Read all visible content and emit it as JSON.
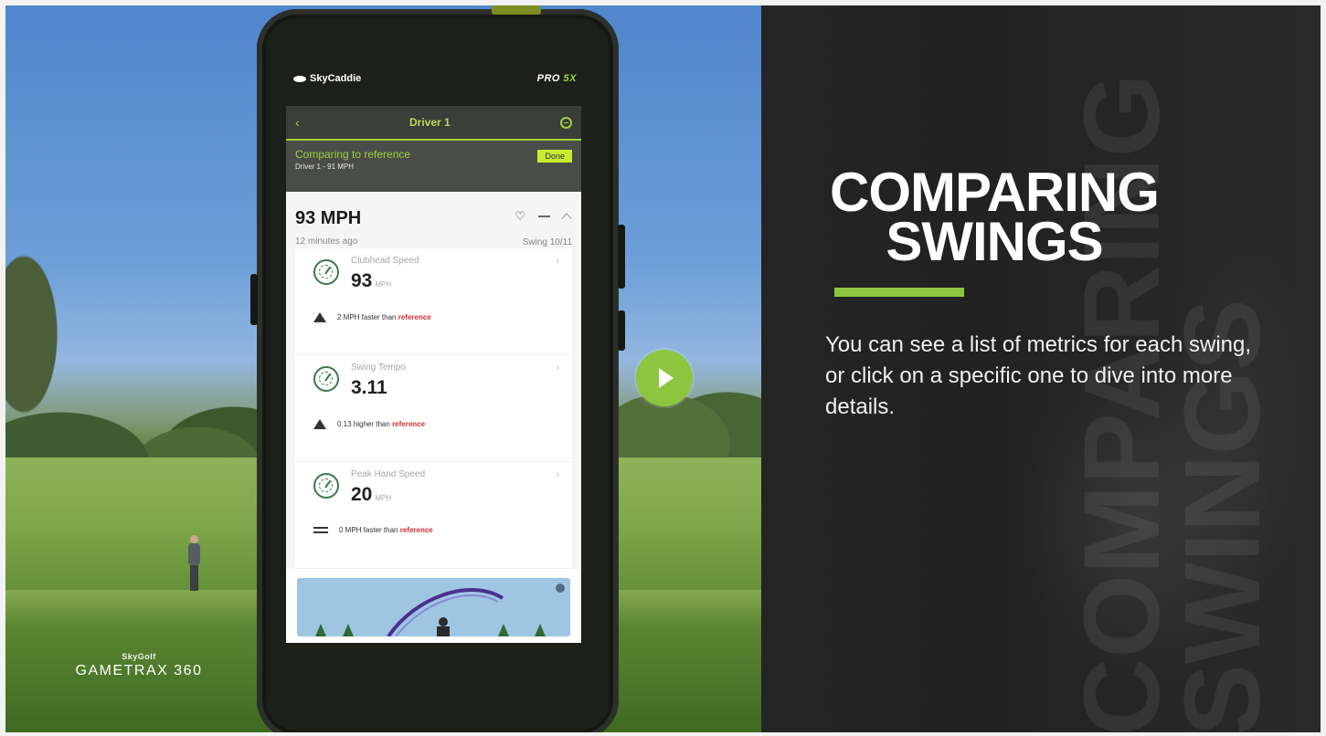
{
  "video": {
    "brand_small": "SkyGolf",
    "brand_product": "GAMETRAX 360",
    "play_button_color": "#8CC63F"
  },
  "phone": {
    "brand": "SkyCaddie",
    "model": "PRO 5X",
    "model_accent": "5X",
    "model_prefix": "PRO ",
    "app_bar": {
      "back_icon": "chevron-left-icon",
      "title": "Driver 1",
      "menu_icon": "more-circle-icon"
    },
    "reference": {
      "title": "Comparing to reference",
      "subtitle": "Driver 1 - 91 MPH",
      "done_label": "Done"
    },
    "swing": {
      "speed": "93 MPH",
      "time_ago": "12 minutes ago",
      "count": "Swing 10/11"
    },
    "metrics": [
      {
        "label": "Clubhead Speed",
        "value": "93",
        "unit": "MPH",
        "compare_icon": "triangle-up-icon",
        "compare_text": "2 MPH faster than",
        "reference_word": "reference"
      },
      {
        "label": "Swing Tempo",
        "value": "3.11",
        "unit": "",
        "compare_icon": "triangle-up-icon",
        "compare_text": "0.13 higher than",
        "reference_word": "reference"
      },
      {
        "label": "Peak Hand Speed",
        "value": "20",
        "unit": "MPH",
        "compare_icon": "equals-icon",
        "compare_text": "0 MPH faster than",
        "reference_word": "reference"
      }
    ]
  },
  "panel": {
    "title_line1": "COMPARING",
    "title_line2": "SWINGS",
    "body": "You can see a list of metrics for each swing, or click on a specific one to dive into more details.",
    "watermark_line1": "COMPARING",
    "watermark_line2": "SWINGS",
    "accent_color": "#8CC63F"
  }
}
